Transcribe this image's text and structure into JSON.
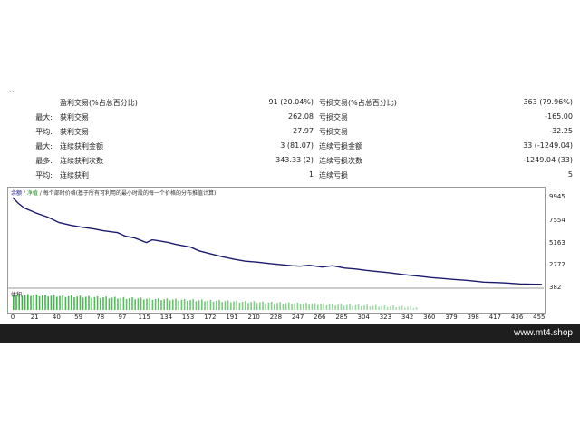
{
  "top_mark": "``",
  "stats": [
    {
      "prefix": "",
      "label1": "盈利交易(%占总百分比)",
      "value1": "91 (20.04%)",
      "label2": "亏损交易(%占总百分比)",
      "value2": "363 (79.96%)"
    },
    {
      "prefix": "最大:",
      "label1": "获利交易",
      "value1": "262.08",
      "label2": "亏损交易",
      "value2": "-165.00"
    },
    {
      "prefix": "平均:",
      "label1": "获利交易",
      "value1": "27.97",
      "label2": "亏损交易",
      "value2": "-32.25"
    },
    {
      "prefix": "最大:",
      "label1": "连续获利金额",
      "value1": "3 (81.07)",
      "label2": "连续亏损金额",
      "value2": "33 (-1249.04)"
    },
    {
      "prefix": "最多:",
      "label1": "连续获利次数",
      "value1": "343.33 (2)",
      "label2": "连续亏损次数",
      "value2": "-1249.04 (33)"
    },
    {
      "prefix": "平均:",
      "label1": "连续获利",
      "value1": "1",
      "label2": "连续亏损",
      "value2": "5"
    }
  ],
  "legend": {
    "balance": "余额",
    "sep": " / ",
    "equity": "净值",
    "desc": " / 每个部时价格(基于所有可利用的最小时段的每一个价格的分布推值计算)"
  },
  "volume_label": "体积",
  "footer_text": "www.mt4.shop",
  "colors": {
    "balance_line": "#1a1a6e",
    "volume_bar": "#3cb043",
    "footer_bg": "#1e1e1e"
  },
  "chart_data": {
    "type": "line",
    "y_ticks": [
      "9945",
      "7554",
      "5163",
      "2772",
      "382"
    ],
    "ylim": [
      382,
      9945
    ],
    "x_ticks": [
      "0",
      "21",
      "40",
      "59",
      "78",
      "97",
      "115",
      "134",
      "153",
      "172",
      "191",
      "210",
      "228",
      "247",
      "266",
      "285",
      "304",
      "323",
      "342",
      "360",
      "379",
      "398",
      "417",
      "436",
      "455"
    ],
    "xlim": [
      0,
      455
    ],
    "series": [
      {
        "x": [
          0,
          5,
          10,
          21,
          30,
          40,
          50,
          59,
          70,
          78,
          90,
          97,
          105,
          115,
          120,
          125,
          134,
          140,
          153,
          160,
          172,
          180,
          191,
          200,
          210,
          220,
          228,
          240,
          247,
          255,
          266,
          275,
          285,
          295,
          304,
          315,
          323,
          335,
          342,
          350,
          360,
          370,
          379,
          390,
          398,
          405,
          417,
          425,
          436,
          445,
          455
        ],
        "y": [
          9945,
          9300,
          8800,
          8200,
          7800,
          7200,
          6900,
          6700,
          6500,
          6300,
          6100,
          5700,
          5500,
          5000,
          5300,
          5200,
          5000,
          4800,
          4500,
          4100,
          3700,
          3450,
          3150,
          2950,
          2850,
          2700,
          2600,
          2450,
          2400,
          2500,
          2300,
          2450,
          2200,
          2100,
          1950,
          1800,
          1700,
          1500,
          1400,
          1300,
          1150,
          1050,
          950,
          850,
          750,
          650,
          600,
          550,
          450,
          420,
          400
        ]
      }
    ],
    "volume_bar_count": 140
  }
}
